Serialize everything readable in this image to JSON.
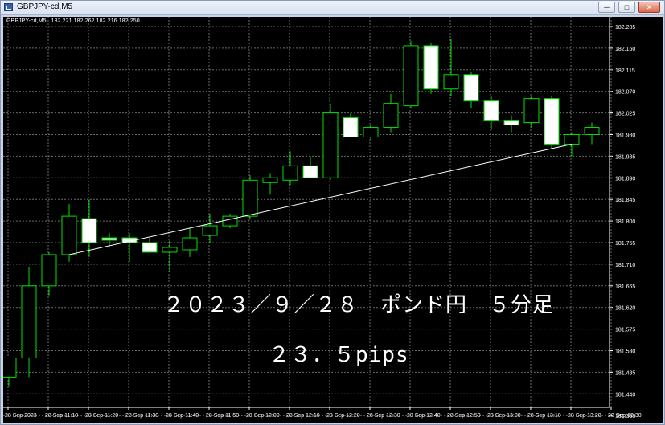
{
  "window": {
    "title": "GBPJPY-cd,M5",
    "controls": {
      "minimize": "─",
      "maximize": "□",
      "close": "✕"
    },
    "icons": [
      "app-icon",
      "minimize-icon",
      "maximize-icon",
      "close-icon"
    ]
  },
  "chart_header": {
    "symbol": "GBPJPY-cd,M5",
    "ohlc": "182.221 182.262 182.216 182.250"
  },
  "annotation": {
    "title": "２０２３／９／２８　ポンド円　５分足",
    "pips": "２３．５pips"
  },
  "colors": {
    "background": "#000000",
    "grid": "#6a6a6a",
    "bull_body": "#000000",
    "bear_body": "#ffffff",
    "candle_outline": "#00e000",
    "trendline": "#ffffff",
    "text": "#ffffff"
  },
  "chart_data": {
    "type": "candlestick",
    "symbol": "GBPJPY-cd",
    "timeframe": "M5",
    "grid": true,
    "x_tick_labels": [
      "28 Sep 2023",
      "28 Sep 11:10",
      "28 Sep 11:20",
      "28 Sep 11:30",
      "28 Sep 11:40",
      "28 Sep 11:50",
      "28 Sep 12:00",
      "28 Sep 12:10",
      "28 Sep 12:20",
      "28 Sep 12:30",
      "28 Sep 12:40",
      "28 Sep 12:50",
      "28 Sep 13:00",
      "28 Sep 13:10",
      "28 Sep 13:20",
      "28 Sep 13:30"
    ],
    "y_tick_labels": [
      "182.205",
      "182.160",
      "182.115",
      "182.070",
      "182.025",
      "181.980",
      "181.935",
      "181.890",
      "181.845",
      "181.800",
      "181.755",
      "181.710",
      "181.665",
      "181.620",
      "181.575",
      "181.530",
      "181.485",
      "181.440",
      "181.395"
    ],
    "ylim": [
      181.395,
      182.205
    ],
    "candles": [
      {
        "open": 181.475,
        "high": 181.51,
        "low": 181.455,
        "close": 181.515
      },
      {
        "open": 181.515,
        "high": 181.705,
        "low": 181.475,
        "close": 181.665
      },
      {
        "open": 181.665,
        "high": 181.735,
        "low": 181.645,
        "close": 181.73
      },
      {
        "open": 181.73,
        "high": 181.835,
        "low": 181.715,
        "close": 181.81
      },
      {
        "open": 181.805,
        "high": 181.845,
        "low": 181.725,
        "close": 181.755
      },
      {
        "open": 181.765,
        "high": 181.775,
        "low": 181.745,
        "close": 181.76
      },
      {
        "open": 181.765,
        "high": 181.775,
        "low": 181.715,
        "close": 181.755
      },
      {
        "open": 181.755,
        "high": 181.765,
        "low": 181.735,
        "close": 181.735
      },
      {
        "open": 181.735,
        "high": 181.76,
        "low": 181.695,
        "close": 181.745
      },
      {
        "open": 181.74,
        "high": 181.785,
        "low": 181.725,
        "close": 181.765
      },
      {
        "open": 181.77,
        "high": 181.815,
        "low": 181.755,
        "close": 181.79
      },
      {
        "open": 181.79,
        "high": 181.815,
        "low": 181.785,
        "close": 181.81
      },
      {
        "open": 181.81,
        "high": 181.895,
        "low": 181.805,
        "close": 181.885
      },
      {
        "open": 181.88,
        "high": 181.9,
        "low": 181.855,
        "close": 181.89
      },
      {
        "open": 181.885,
        "high": 181.945,
        "low": 181.875,
        "close": 181.915
      },
      {
        "open": 181.915,
        "high": 181.935,
        "low": 181.89,
        "close": 181.89
      },
      {
        "open": 181.89,
        "high": 182.045,
        "low": 181.885,
        "close": 182.025
      },
      {
        "open": 182.015,
        "high": 182.025,
        "low": 181.975,
        "close": 181.975
      },
      {
        "open": 181.975,
        "high": 182.0,
        "low": 181.97,
        "close": 181.995
      },
      {
        "open": 181.995,
        "high": 182.065,
        "low": 181.985,
        "close": 182.045
      },
      {
        "open": 182.04,
        "high": 182.175,
        "low": 182.035,
        "close": 182.165
      },
      {
        "open": 182.165,
        "high": 182.17,
        "low": 182.065,
        "close": 182.075
      },
      {
        "open": 182.075,
        "high": 182.18,
        "low": 182.06,
        "close": 182.105
      },
      {
        "open": 182.105,
        "high": 182.11,
        "low": 182.035,
        "close": 182.05
      },
      {
        "open": 182.05,
        "high": 182.06,
        "low": 181.99,
        "close": 182.01
      },
      {
        "open": 182.01,
        "high": 182.02,
        "low": 181.985,
        "close": 182.0
      },
      {
        "open": 182.005,
        "high": 182.06,
        "low": 181.995,
        "close": 182.055
      },
      {
        "open": 182.055,
        "high": 182.06,
        "low": 181.95,
        "close": 181.96
      },
      {
        "open": 181.96,
        "high": 181.985,
        "low": 181.935,
        "close": 181.98
      },
      {
        "open": 181.98,
        "high": 182.005,
        "low": 181.96,
        "close": 181.995
      },
      {
        "open": 181.995,
        "high": 182.025,
        "low": 181.985,
        "close": 182.02
      },
      {
        "open": 182.02,
        "high": 182.025,
        "low": 182.01,
        "close": 182.015
      }
    ],
    "trendline": {
      "from": {
        "candle": 3,
        "price": 181.73
      },
      "to": {
        "candle": 28,
        "price": 181.96
      }
    }
  }
}
